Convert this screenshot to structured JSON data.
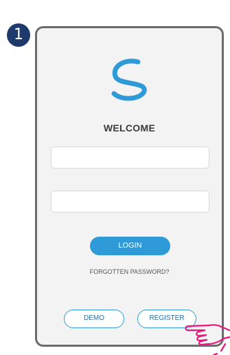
{
  "step": {
    "number": "1"
  },
  "app": {
    "logo_icon": "swirl-logo",
    "welcome": "WELCOME"
  },
  "form": {
    "field_1_value": "",
    "field_2_value": ""
  },
  "buttons": {
    "login": "LOGIN",
    "forgotten_password": "FORGOTTEN PASSWORD?",
    "demo": "DEMO",
    "register": "REGISTER"
  },
  "pointer": {
    "icon": "pointing-hand-icon"
  },
  "colors": {
    "badge": "#1e3a6d",
    "accent": "#2f9ad8",
    "hand": "#e8157a",
    "phone_frame": "#6b6b6b",
    "phone_bg": "#f3f3f3"
  }
}
